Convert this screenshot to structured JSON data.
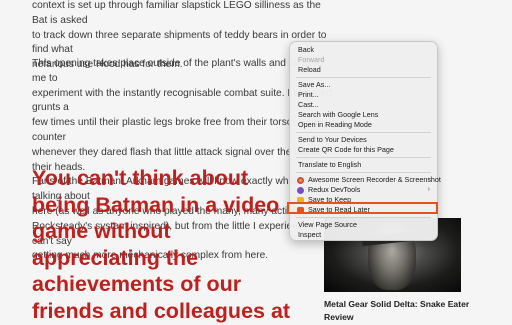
{
  "article": {
    "para1_lines": [
      "context is set up through familiar slapstick LEGO silliness as the Bat is asked",
      "to track down three separate shipments of teddy bears in order to find what",
      "nefarious use Hood has for them."
    ],
    "para2_lines": [
      "This opening takes place outside of the plant's walls and allowed me to",
      "experiment with the instantly recognisable combat suite. I punched grunts a",
      "few times until their plastic legs broke free from their torsos and counter",
      "whenever they dared flash that little attack signal over the top of their heads.",
      "Fans of the Batman: Arkham games will know exactly what I'm talking about",
      "here (as well as anyone who played the many, many action games",
      "Rocksteady's system inspired), but from the little I experienced, I can't say",
      "getting much more mechanically complex from here."
    ],
    "pull_quote_lines": [
      "You can't think about",
      "being Batman in a video",
      "game without",
      "appreciating the",
      "achievements of our",
      "friends and colleagues at"
    ]
  },
  "related": {
    "caption_lines": [
      "Metal Gear Solid Delta: Snake Eater",
      "Review"
    ]
  },
  "context_menu": {
    "back": "Back",
    "forward": "Forward",
    "reload": "Reload",
    "save_as": "Save As...",
    "print": "Print...",
    "cast": "Cast...",
    "search_lens": "Search with Google Lens",
    "reading_mode": "Open in Reading Mode",
    "send_devices": "Send to Your Devices",
    "qr_code": "Create QR Code for this Page",
    "translate": "Translate to English",
    "ext_screen_recorder": "Awesome Screen Recorder & Screenshot",
    "ext_redux": "Redux DevTools",
    "ext_keep": "Save to Keep",
    "ext_read_later": "Save to Read Later",
    "view_source": "View Page Source",
    "inspect": "Inspect",
    "submenu_arrow": "›"
  },
  "colors": {
    "accent_red": "#c0201d",
    "highlight_orange": "#e5531a"
  },
  "icons": {
    "screen_recorder": "screen-recorder-icon",
    "redux": "redux-devtools-icon",
    "keep": "google-keep-icon",
    "read_later": "bookmark-icon"
  }
}
